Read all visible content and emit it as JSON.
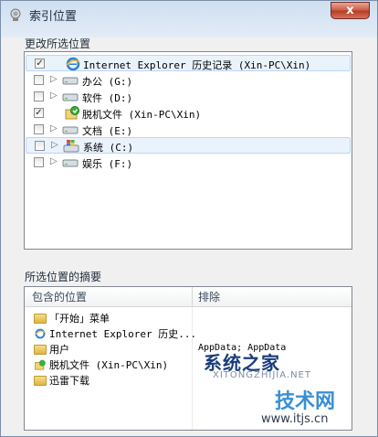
{
  "window": {
    "title": "索引位置",
    "close_label": "x"
  },
  "change_section": {
    "label": "更改所选位置",
    "rows": [
      {
        "label": "Internet Explorer 历史记录 (Xin-PC\\Xin)",
        "checked": true,
        "icon": "ie-icon"
      },
      {
        "label": "办公 (G:)",
        "checked": false,
        "icon": "drive-icon"
      },
      {
        "label": "软件 (D:)",
        "checked": false,
        "icon": "drive-icon"
      },
      {
        "label": "脱机文件 (Xin-PC\\Xin)",
        "checked": true,
        "icon": "offline-files-icon"
      },
      {
        "label": "文档 (E:)",
        "checked": false,
        "icon": "drive-icon"
      },
      {
        "label": "系统 (C:)",
        "checked": false,
        "icon": "system-drive-icon"
      },
      {
        "label": "娱乐 (F:)",
        "checked": false,
        "icon": "drive-icon"
      }
    ]
  },
  "summary_section": {
    "label": "所选位置的摘要",
    "col_included": "包含的位置",
    "col_excluded": "排除",
    "items": [
      {
        "label": "「开始」菜单",
        "icon": "folder-icon"
      },
      {
        "label": "Internet Explorer 历史...",
        "icon": "ie-icon"
      },
      {
        "label": "用户",
        "icon": "folder-icon"
      },
      {
        "label": "脱机文件 (Xin-PC\\Xin)",
        "icon": "offline-files-icon"
      },
      {
        "label": "迅雷下载",
        "icon": "folder-icon"
      }
    ],
    "excluded_text": "AppData; AppData"
  },
  "watermark": {
    "brand": "系统之家",
    "brand_en": "XITONGZHIJIA.NET",
    "logo_text": "技术网",
    "url": "www.itjs.cn"
  }
}
